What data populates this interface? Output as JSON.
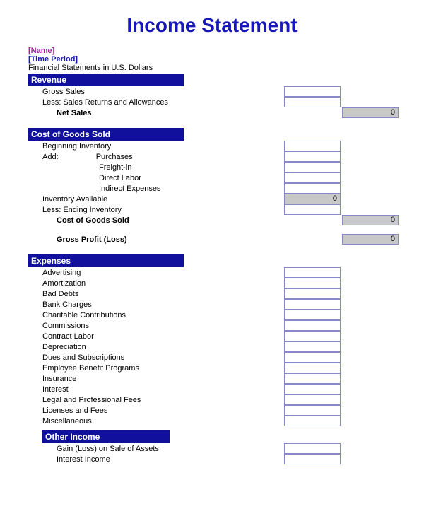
{
  "title": "Income Statement",
  "meta": {
    "name": "[Name]",
    "period": "[Time Period]",
    "currency": "Financial Statements in U.S. Dollars"
  },
  "sections": {
    "revenue": {
      "header": "Revenue",
      "gross_sales": "Gross Sales",
      "returns": "Less: Sales Returns and Allowances",
      "net_sales": "Net Sales",
      "net_sales_value": "0"
    },
    "cogs": {
      "header": "Cost of Goods Sold",
      "beginning_inventory": "Beginning Inventory",
      "add": "Add:",
      "purchases": "Purchases",
      "freight_in": "Freight-in",
      "direct_labor": "Direct Labor",
      "indirect_expenses": "Indirect Expenses",
      "inventory_available": "Inventory Available",
      "inventory_available_value": "0",
      "ending_inventory": "Less: Ending Inventory",
      "cogs_total": "Cost of Goods Sold",
      "cogs_value": "0",
      "gross_profit": "Gross Profit (Loss)",
      "gross_profit_value": "0"
    },
    "expenses": {
      "header": "Expenses",
      "items": [
        "Advertising",
        "Amortization",
        "Bad Debts",
        "Bank Charges",
        "Charitable Contributions",
        "Commissions",
        "Contract Labor",
        "Depreciation",
        "Dues and Subscriptions",
        "Employee Benefit Programs",
        "Insurance",
        "Interest",
        "Legal and Professional Fees",
        "Licenses and Fees",
        "Miscellaneous"
      ]
    },
    "other_income": {
      "header": "Other Income",
      "gain_loss": "Gain (Loss) on Sale of Assets",
      "interest_income": "Interest Income"
    }
  }
}
